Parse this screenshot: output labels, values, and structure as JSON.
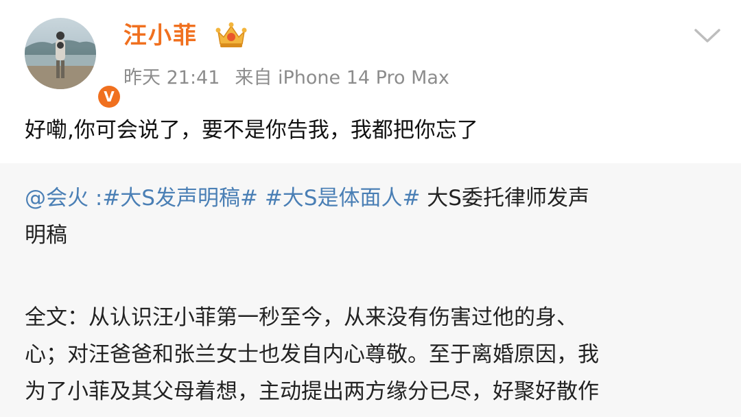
{
  "header": {
    "username": "汪小菲",
    "time": "昨天 21:41",
    "source": "来自 iPhone 14 Pro Max",
    "verified_badge": "V",
    "icons": {
      "crown": "crown-badge-icon",
      "chevron": "chevron-down-icon"
    }
  },
  "post": {
    "text": "好嘞,你可会说了，要不是你告我，我都把你忘了"
  },
  "repost": {
    "mention": "@会火",
    "separator": " :",
    "hashtag1": "#大S发声明稿#",
    "hashtag2": "#大S是体面人#",
    "text_line1": " 大S委托律师发声",
    "text_line2": "明稿",
    "body_lines": [
      "全文：从认识汪小菲第一秒至今，从来没有伤害过他的身、",
      "心；对汪爸爸和张兰女士也发自内心尊敬。至于离婚原因，我",
      "为了小菲及其父母着想，主动提出两方缘分已尽，好聚好散作"
    ]
  },
  "colors": {
    "username": "#f0701f",
    "link": "#4a7fb5",
    "meta": "#8c8c8c",
    "repost_bg": "#f7f7f7",
    "badge": "#f0701f"
  }
}
